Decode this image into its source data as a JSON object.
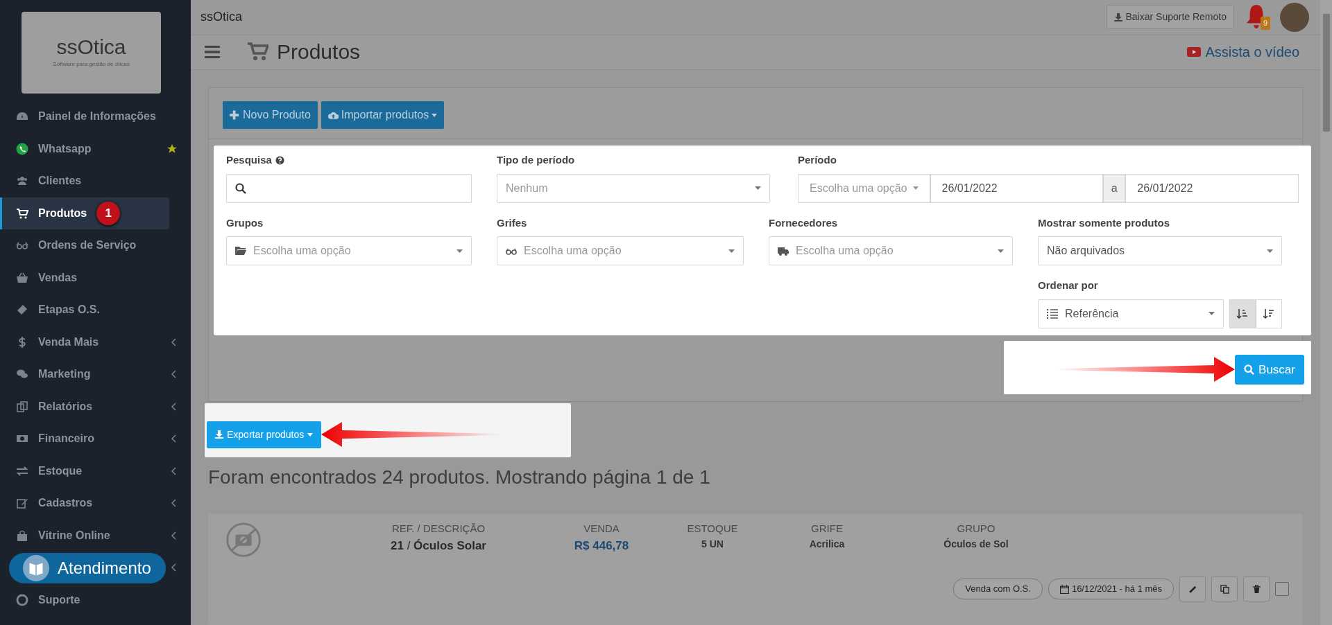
{
  "sidebar": {
    "logo": {
      "wordmark": "ssOtica",
      "tagline": "Software para gestão de óticas"
    },
    "items": [
      {
        "label": "Painel de Informações",
        "selected": false,
        "expandable": false
      },
      {
        "label": "Whatsapp",
        "selected": false,
        "expandable": false,
        "starred": true
      },
      {
        "label": "Clientes",
        "selected": false,
        "expandable": false
      },
      {
        "label": "Produtos",
        "selected": true,
        "expandable": false,
        "badge": "1"
      },
      {
        "label": "Ordens de Serviço",
        "selected": false,
        "expandable": false
      },
      {
        "label": "Vendas",
        "selected": false,
        "expandable": false
      },
      {
        "label": "Etapas O.S.",
        "selected": false,
        "expandable": false
      },
      {
        "label": "Venda Mais",
        "selected": false,
        "expandable": true
      },
      {
        "label": "Marketing",
        "selected": false,
        "expandable": true
      },
      {
        "label": "Relatórios",
        "selected": false,
        "expandable": true
      },
      {
        "label": "Financeiro",
        "selected": false,
        "expandable": true
      },
      {
        "label": "Estoque",
        "selected": false,
        "expandable": true
      },
      {
        "label": "Cadastros",
        "selected": false,
        "expandable": true
      },
      {
        "label": "Vitrine Online",
        "selected": false,
        "expandable": true
      },
      {
        "expandable": true
      },
      {
        "label": "Suporte",
        "selected": false,
        "expandable": false
      }
    ],
    "chat_button": {
      "label": "Atendimento"
    }
  },
  "topbar": {
    "logo": "ssOtica",
    "support_button": "Baixar Suporte Remoto",
    "notifications": "9"
  },
  "page_header": {
    "title": "Produtos",
    "video_link": "Assista o vídeo"
  },
  "toolbar": {
    "buttons": [
      {
        "label": "Novo Produto",
        "dropdown": false
      },
      {
        "label": "Importar produtos",
        "dropdown": true
      }
    ]
  },
  "filters": [
    {
      "kind": "search",
      "label": "Pesquisa",
      "help": true
    },
    {
      "kind": "select",
      "label": "Tipo de período",
      "placeholder": "Nenhum"
    },
    {
      "kind": "range",
      "label": "Período",
      "placeholder": "Escolha uma opção",
      "from": "26/01/2022",
      "separator": "a",
      "to": "26/01/2022"
    },
    {
      "kind": "select",
      "label": "Grupos",
      "placeholder": "Escolha uma opção"
    },
    {
      "kind": "select",
      "label": "Grifes",
      "placeholder": "Escolha uma opção"
    },
    {
      "kind": "select",
      "label": "Fornecedores",
      "placeholder": "Escolha uma opção"
    },
    {
      "kind": "select",
      "label": "Mostrar somente produtos",
      "value": "Não arquivados"
    },
    {
      "kind": "sort",
      "label": "Ordenar por",
      "value": "Referência",
      "order_buttons": [
        {
          "selected": true
        },
        {
          "selected": false
        }
      ]
    }
  ],
  "search_button": "Buscar",
  "export_button": "Exportar produtos",
  "result_summary": "Foram encontrados 24 produtos. Mostrando página 1 de 1",
  "products": [
    {
      "columns": [
        {
          "heading": "REF. / DESCRIÇÃO",
          "value": "**21** / **Óculos Solar**",
          "kind": "text"
        },
        {
          "heading": "VENDA",
          "value": "R$ 446,78",
          "kind": "price"
        },
        {
          "heading": "ESTOQUE",
          "value": "**5** UN",
          "kind": "small"
        },
        {
          "heading": "GRIFE",
          "value": "Acrilica",
          "kind": "small"
        },
        {
          "heading": "GRUPO",
          "value": "Óculos de Sol",
          "kind": "small"
        }
      ],
      "tag": "Venda com O.S.",
      "date": "16/12/2021 - há 1 mês",
      "checked": false
    }
  ]
}
